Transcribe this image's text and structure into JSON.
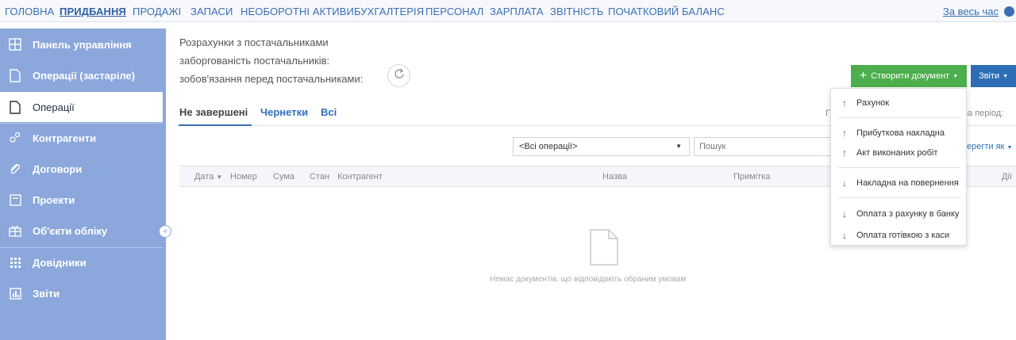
{
  "topnav": {
    "items": [
      "ГОЛОВНА",
      "ПРИДБАННЯ",
      "ПРОДАЖІ",
      "ЗАПАСИ",
      "НЕОБОРОТНІ АКТИВИ",
      "БУХГАЛТЕРІЯ",
      "ПЕРСОНАЛ",
      "ЗАРПЛАТА",
      "ЗВІТНІСТЬ",
      "ПОЧАТКОВИЙ БАЛАНС"
    ],
    "active_index": 1,
    "period_link": "За весь час",
    "help_icon": "help-icon"
  },
  "sidebar": {
    "items": [
      {
        "label": "Панель управління",
        "icon": "dashboard-icon"
      },
      {
        "label": "Операції (застаріле)",
        "icon": "document-icon"
      },
      {
        "label": "Операції",
        "icon": "document-icon"
      },
      {
        "label": "Контрагенти",
        "icon": "contacts-icon"
      },
      {
        "label": "Договори",
        "icon": "paperclip-icon"
      },
      {
        "label": "Проекти",
        "icon": "folder-icon"
      },
      {
        "label": "Об'єкти обліку",
        "icon": "gift-icon"
      },
      {
        "label": "Довідники",
        "icon": "grid-icon"
      },
      {
        "label": "Звіти",
        "icon": "report-icon"
      }
    ],
    "active_index": 2,
    "collapse_icon": "collapse-icon"
  },
  "header": {
    "line1": "Розрахунки з постачальниками",
    "line2": "заборгованість постачальників:",
    "line3": "зобов'язання перед постачальниками:"
  },
  "buttons": {
    "create": "Створити документ",
    "reports": "Звіти"
  },
  "tabs": [
    "Не завершені",
    "Чернетки",
    "Всі"
  ],
  "period_label": "за період:",
  "period_trunc": "П",
  "filters": {
    "operations_select": "<Всі операції>",
    "search_placeholder": "Пошук",
    "sort_link": "ерегти як"
  },
  "table": {
    "columns": [
      "Дата",
      "Номер",
      "Сума",
      "Стан",
      "Контрагент",
      "Назва",
      "Примітка",
      "Дії"
    ]
  },
  "empty": {
    "message": "Немає документів, що відповідають обраним умовам"
  },
  "dropdown": {
    "items": [
      {
        "label": "Рахунок",
        "arrow": "↑"
      },
      {
        "label": "Прибуткова накладна",
        "arrow": "↑"
      },
      {
        "label": "Акт виконаних робіт",
        "arrow": "↑"
      },
      {
        "label": "Накладна на повернення",
        "arrow": "↓"
      },
      {
        "label": "Оплата з рахунку в банку",
        "arrow": "↓"
      },
      {
        "label": "Оплата готівкою з каси",
        "arrow": "↓"
      }
    ]
  },
  "colors": {
    "sidebar": "#8ba7dc",
    "create_button": "#4cae4c",
    "reports_button": "#2d6db6",
    "link": "#3a6fb5"
  }
}
